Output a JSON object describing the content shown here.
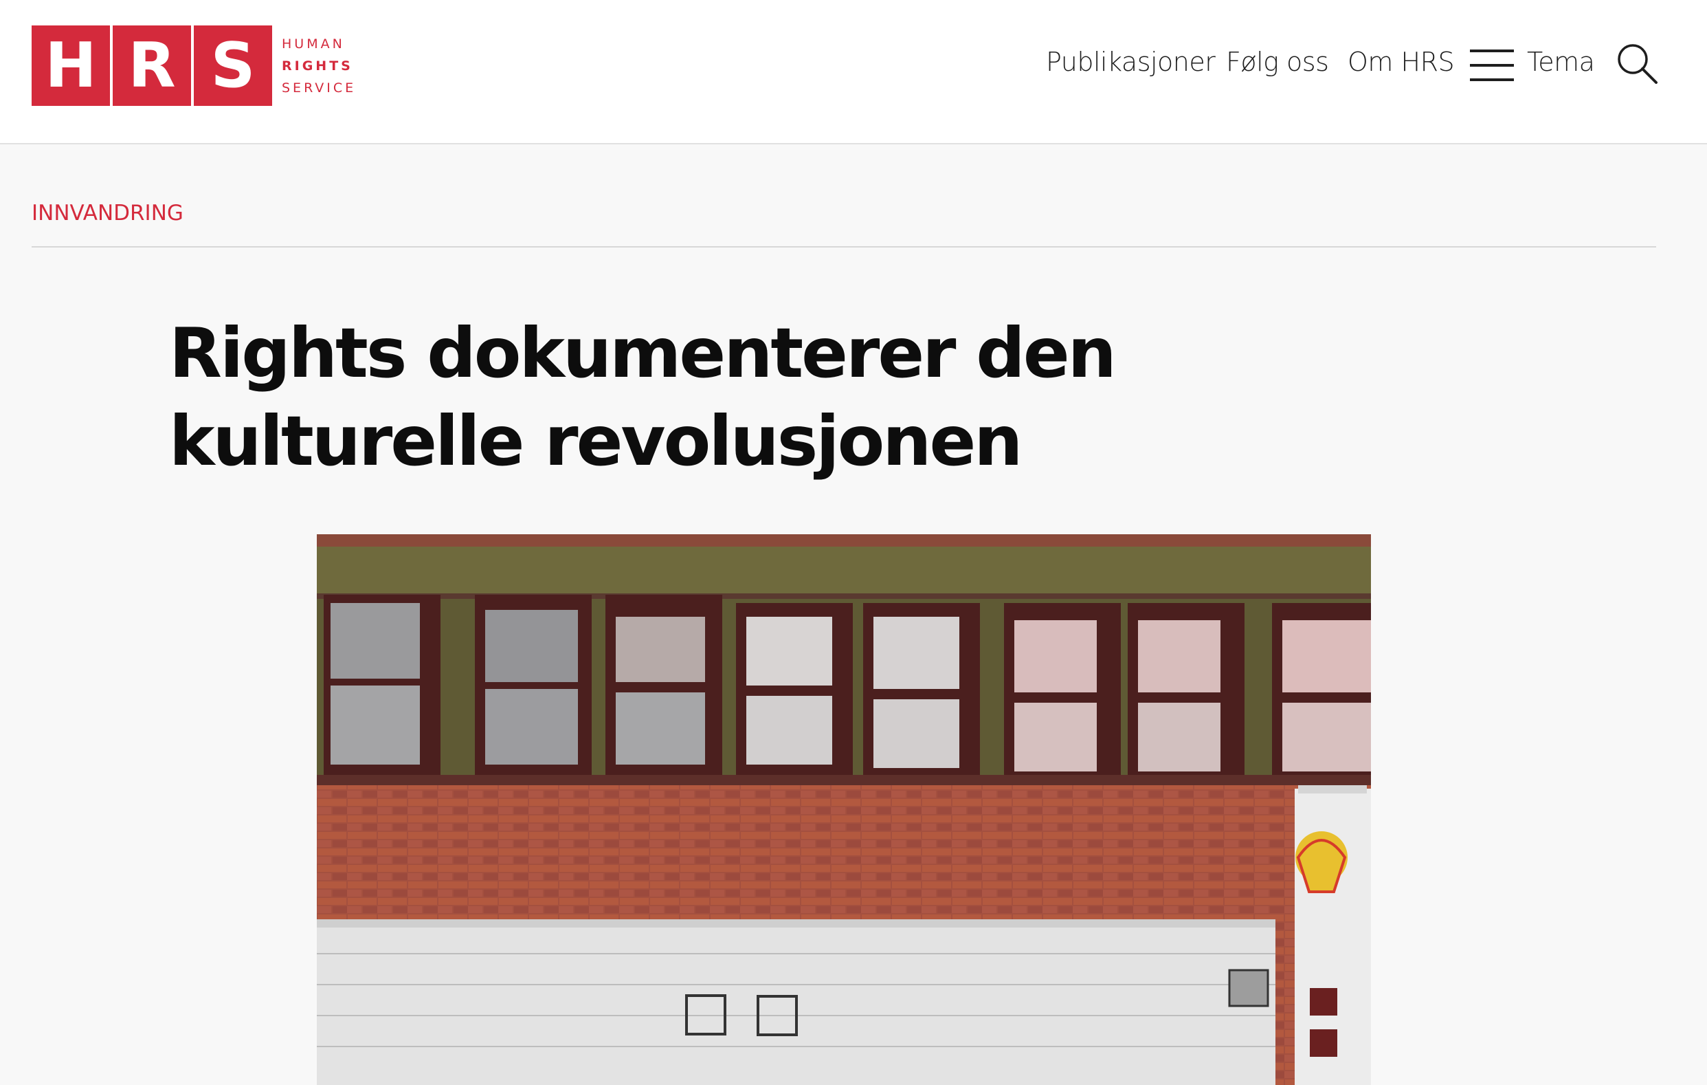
{
  "logo": {
    "letters": [
      "H",
      "R",
      "S"
    ],
    "words": [
      "HUMAN",
      "RIGHTS",
      "SERVICE"
    ]
  },
  "nav": {
    "items": [
      "Publikasjoner",
      "Følg oss",
      "Om HRS"
    ],
    "menu_label": "Tema",
    "menu_icon": "hamburger-icon",
    "search_icon": "search-icon"
  },
  "article": {
    "category": "INNVANDRING",
    "title": "Rights dokumenterer den kulturelle revolusjonen"
  },
  "colors": {
    "brand_red": "#d42a3c",
    "background": "#f8f8f8",
    "header_bg": "#ffffff"
  }
}
